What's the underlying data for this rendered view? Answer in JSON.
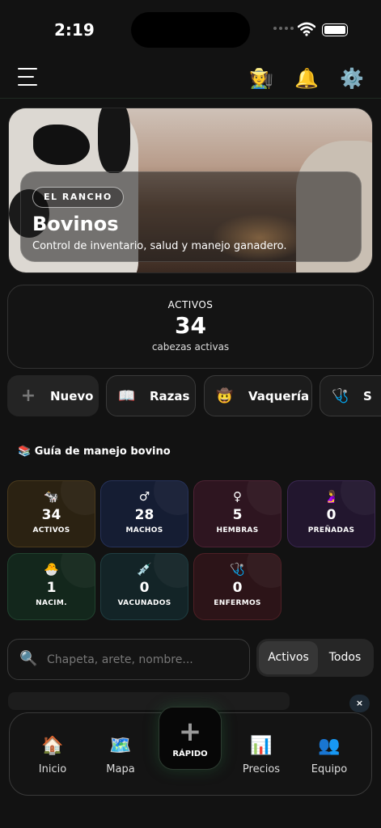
{
  "status_bar": {
    "time": "2:19"
  },
  "hero": {
    "badge": "EL RANCHO",
    "title": "Bovinos",
    "subtitle": "Control de inventario, salud y manejo ganadero."
  },
  "summary": {
    "label": "ACTIVOS",
    "value": "34",
    "caption": "cabezas activas"
  },
  "chips": [
    {
      "icon": "plus-icon",
      "label": "Nuevo"
    },
    {
      "icon": "book-icon",
      "label": "Razas"
    },
    {
      "icon": "cowboy-icon",
      "label": "Vaquería"
    },
    {
      "icon": "stethoscope-icon",
      "label": "S"
    }
  ],
  "guide": {
    "label": "Guía de manejo bovino"
  },
  "stats": [
    {
      "icon": "cow-icon",
      "value": "34",
      "label": "ACTIVOS",
      "bg": "#2b2212",
      "border": "#4a3a1c"
    },
    {
      "icon": "male-icon",
      "value": "28",
      "label": "MACHOS",
      "bg": "#151d33",
      "border": "#26325a"
    },
    {
      "icon": "female-icon",
      "value": "5",
      "label": "HEMBRAS",
      "bg": "#2e1520",
      "border": "#4e2234"
    },
    {
      "icon": "pregnant-icon",
      "value": "0",
      "label": "PREÑADAS",
      "bg": "#22162e",
      "border": "#3b2752"
    },
    {
      "icon": "chick-icon",
      "value": "1",
      "label": "NACIM.",
      "bg": "#13271c",
      "border": "#21432f"
    },
    {
      "icon": "syringe-icon",
      "value": "0",
      "label": "VACUNADOS",
      "bg": "#132427",
      "border": "#1f3e42"
    },
    {
      "icon": "stethoscope-icon",
      "value": "0",
      "label": "ENFERMOS",
      "bg": "#2c1418",
      "border": "#4e1f25"
    }
  ],
  "search": {
    "placeholder": "Chapeta, arete, nombre..."
  },
  "filter": {
    "active": "Activos",
    "all": "Todos"
  },
  "close_label": "×",
  "nav": {
    "items": [
      {
        "icon": "house-icon",
        "label": "Inicio"
      },
      {
        "icon": "map-icon",
        "label": "Mapa"
      },
      {
        "icon": "chart-icon",
        "label": "Precios"
      },
      {
        "icon": "team-icon",
        "label": "Equipo"
      }
    ],
    "fab_symbol": "+",
    "fab_label": "RÁPIDO"
  }
}
